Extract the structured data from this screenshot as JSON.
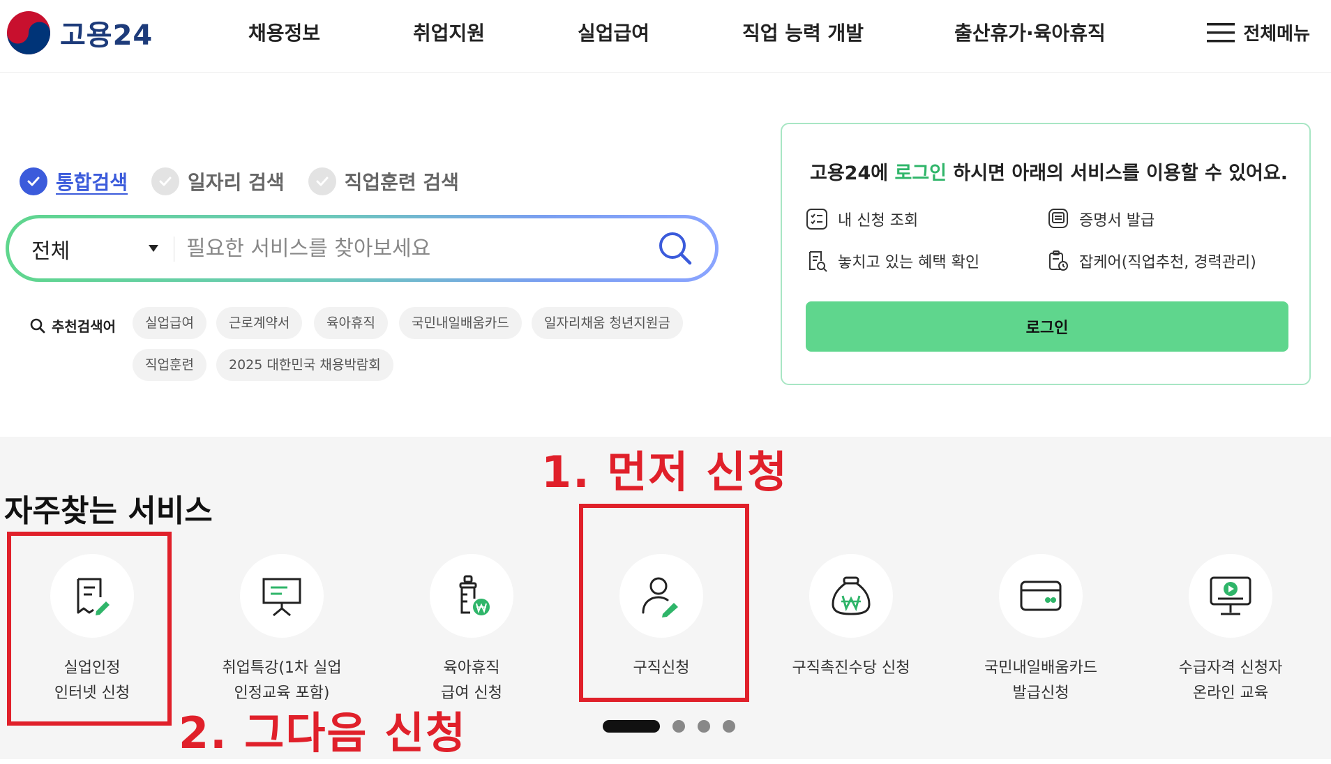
{
  "header": {
    "logo_text": "고용24",
    "nav": [
      "채용정보",
      "취업지원",
      "실업급여",
      "직업 능력 개발",
      "출산휴가·육아휴직"
    ],
    "all_menu": "전체메뉴"
  },
  "search": {
    "tabs": [
      {
        "label": "통합검색",
        "active": true
      },
      {
        "label": "일자리 검색",
        "active": false
      },
      {
        "label": "직업훈련 검색",
        "active": false
      }
    ],
    "category": "전체",
    "placeholder": "필요한 서비스를 찾아보세요",
    "recommend_label": "추천검색어",
    "keywords": [
      "실업급여",
      "근로계약서",
      "육아휴직",
      "국민내일배움카드",
      "일자리채움 청년지원금",
      "직업훈련",
      "2025 대한민국 채용박람회"
    ]
  },
  "login_box": {
    "message_pre": "고용24에 ",
    "message_highlight": "로그인",
    "message_post": " 하시면 아래의 서비스를 이용할 수 있어요.",
    "services": [
      {
        "label": "내 신청 조회",
        "icon": "checklist-icon"
      },
      {
        "label": "증명서 발급",
        "icon": "certificate-icon"
      },
      {
        "label": "놓치고 있는 혜택 확인",
        "icon": "benefit-search-icon"
      },
      {
        "label": "잡케어(직업추천, 경력관리)",
        "icon": "jobcare-icon"
      }
    ],
    "button_label": "로그인",
    "accent_color": "#5fd68d"
  },
  "favorites": {
    "title": "자주찾는 서비스",
    "items": [
      {
        "label": "실업인정\n인터넷 신청",
        "icon": "document-pen-icon"
      },
      {
        "label": "취업특강(1차 실업\n인정교육 포함)",
        "icon": "presentation-board-icon"
      },
      {
        "label": "육아휴직\n급여 신청",
        "icon": "baby-bottle-won-icon"
      },
      {
        "label": "구직신청",
        "icon": "person-pen-icon"
      },
      {
        "label": "구직촉진수당 신청",
        "icon": "money-bag-won-icon"
      },
      {
        "label": "국민내일배움카드\n발급신청",
        "icon": "card-icon"
      },
      {
        "label": "수급자격 신청자\n온라인 교육",
        "icon": "monitor-play-icon"
      }
    ],
    "pagination": {
      "current": 1,
      "total": 4
    }
  },
  "annotations": {
    "first": "1. 먼저 신청",
    "second": "2. 그다음 신청",
    "color": "#e0202a"
  }
}
